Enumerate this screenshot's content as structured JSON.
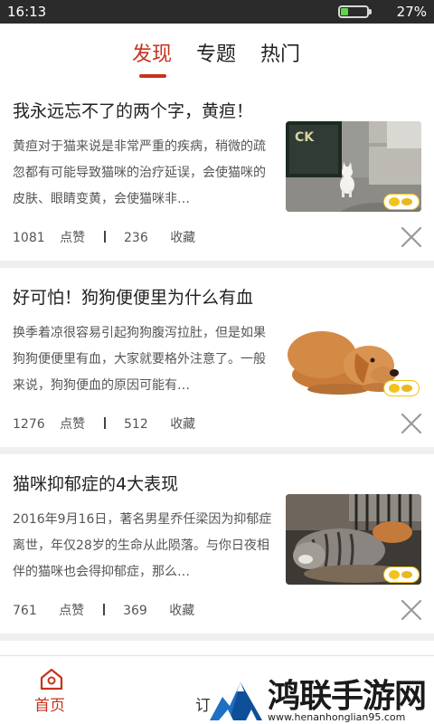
{
  "status_bar": {
    "time": "16:13",
    "battery_percent": "27%",
    "battery_level": 0.27
  },
  "tabs": [
    {
      "label": "发现",
      "active": true
    },
    {
      "label": "专题",
      "active": false
    },
    {
      "label": "热门",
      "active": false
    }
  ],
  "articles": [
    {
      "title": "我永远忘不了的两个字，黄疸！",
      "summary": "黄疸对于猫来说是非常严重的疾病，稍微的疏忽都有可能导致猫咪的治疗延误，会使猫咪的皮肤、眼睛变黄，会使猫咪非…",
      "likes": "1081",
      "likes_label": "点赞",
      "favorites": "236",
      "favorites_label": "收藏",
      "image": "white-cat-photo"
    },
    {
      "title": "好可怕！狗狗便便里为什么有血",
      "summary": "换季着凉很容易引起狗狗腹泻拉肚，但是如果狗狗便便里有血，大家就要格外注意了。一般来说，狗狗便血的原因可能有…",
      "likes": "1276",
      "likes_label": "点赞",
      "favorites": "512",
      "favorites_label": "收藏",
      "image": "dog-lying-photo"
    },
    {
      "title": "猫咪抑郁症的4大表现",
      "summary": "2016年9月16日，著名男星乔任梁因为抑郁症离世，年仅28岁的生命从此陨落。与你日夜相伴的猫咪也会得抑郁症，那么…",
      "likes": "761",
      "likes_label": "点赞",
      "favorites": "369",
      "favorites_label": "收藏",
      "image": "tabby-cat-sleeping-photo"
    }
  ],
  "bottom_nav": {
    "home_label": "首页",
    "second_label": "订"
  },
  "watermark": {
    "name": "鸿联手游网",
    "url": "www.henanhonglian95.com"
  },
  "colors": {
    "accent": "#c8321e",
    "battery": "#5dd44a"
  }
}
